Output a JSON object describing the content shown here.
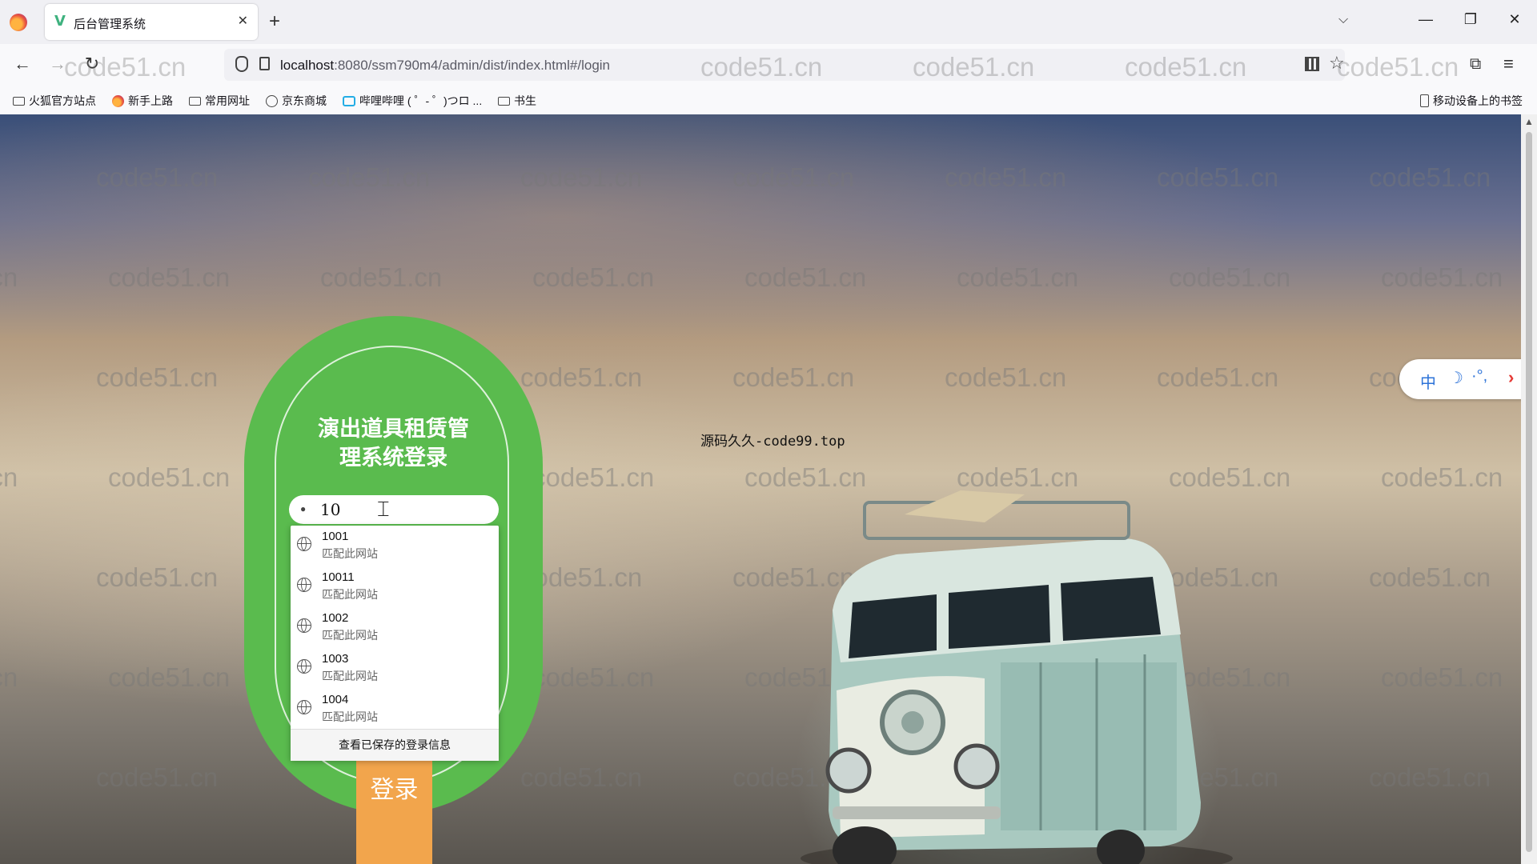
{
  "browser": {
    "tab_title": "后台管理系统",
    "tab_close": "✕",
    "new_tab": "+",
    "tab_list": "⌵",
    "url_host": "localhost",
    "url_rest": ":8080/ssm790m4/admin/dist/index.html#/login",
    "window_minimize": "—",
    "window_restore": "❐",
    "window_close": "✕"
  },
  "bookmarks": [
    {
      "label": "火狐官方站点",
      "icon": "folder-icon"
    },
    {
      "label": "新手上路",
      "icon": "firefox-icon"
    },
    {
      "label": "常用网址",
      "icon": "folder-icon"
    },
    {
      "label": "京东商城",
      "icon": "globe-icon"
    },
    {
      "label": "哔哩哔哩 ( ゜- ゜)つロ ...",
      "icon": "tv-icon"
    },
    {
      "label": "书生",
      "icon": "folder-icon"
    }
  ],
  "mobile_bookmarks": "移动设备上的书签",
  "watermark": "code51.cn",
  "page": {
    "source_text": "源码久久-code99.top",
    "login": {
      "title_line1": "演出道具租赁管",
      "title_line2": "理系统登录",
      "username_value": "10",
      "login_button": "登录"
    },
    "autocomplete": {
      "items": [
        {
          "value": "1001",
          "hint": "匹配此网站"
        },
        {
          "value": "10011",
          "hint": "匹配此网站"
        },
        {
          "value": "1002",
          "hint": "匹配此网站"
        },
        {
          "value": "1003",
          "hint": "匹配此网站"
        },
        {
          "value": "1004",
          "hint": "匹配此网站"
        }
      ],
      "footer": "查看已保存的登录信息"
    },
    "translator": {
      "lang": "中",
      "moon": "☽",
      "dots": "·°,",
      "arrow": "›"
    }
  },
  "colors": {
    "card_green": "#5abb4e",
    "login_orange": "#f2a54c",
    "translator_blue": "#2d73d8"
  }
}
